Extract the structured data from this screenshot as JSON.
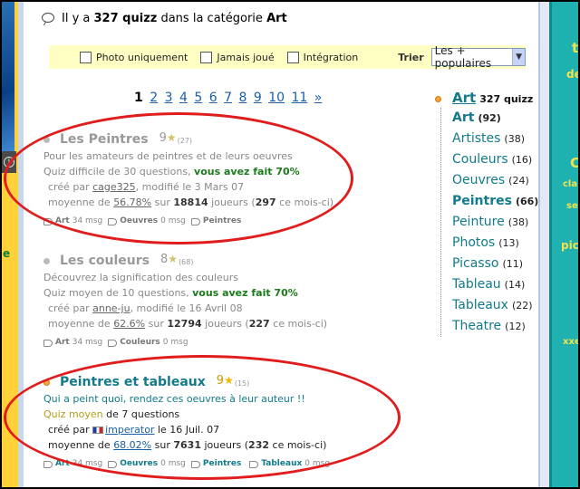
{
  "header": {
    "prefix": "Il y a",
    "count": "327 quizz",
    "middle": "dans la catégorie",
    "category": "Art"
  },
  "filters": {
    "options": [
      "Photo uniquement",
      "Jamais joué",
      "Intégration"
    ],
    "sort_label": "Trier",
    "sort_value": "Les + populaires"
  },
  "pagination": {
    "pages": [
      "1",
      "2",
      "3",
      "4",
      "5",
      "6",
      "7",
      "8",
      "9",
      "10",
      "11",
      "»"
    ],
    "current": "1"
  },
  "quizzes": [
    {
      "title": "Les Peintres",
      "rating": "9",
      "votes": "(27)",
      "desc": "Pour les amateurs de peintres et de leurs oeuvres",
      "level_text": "Quiz difficile de 30 questions,",
      "done": "vous avez fait 70%",
      "created_prefix": "créé par",
      "author": "cage325",
      "modified": ", modifié le 3 Mars 07",
      "avg_prefix": "moyenne de",
      "avg": "56.78%",
      "players_prefix": "sur",
      "players": "18814",
      "players_suffix": "joueurs (",
      "month": "297",
      "month_suffix": "ce mois-ci)",
      "tags": [
        {
          "name": "Art",
          "count": "34 msg"
        },
        {
          "name": "Oeuvres",
          "count": "0 msg"
        },
        {
          "name": "Peintres",
          "count": ""
        }
      ]
    },
    {
      "title": "Les couleurs",
      "rating": "8",
      "votes": "(68)",
      "desc": "Découvrez la signification des couleurs",
      "level_text": "Quiz moyen de 10 questions,",
      "done": "vous avez fait 70%",
      "created_prefix": "créé par",
      "author": "anne-ju",
      "modified": ", modifié le 16 Avril 08",
      "avg_prefix": "moyenne de",
      "avg": "62.6%",
      "players_prefix": "sur",
      "players": "12794",
      "players_suffix": "joueurs (",
      "month": "227",
      "month_suffix": "ce mois-ci)",
      "tags": [
        {
          "name": "Art",
          "count": "34 msg"
        },
        {
          "name": "Couleurs",
          "count": "0 msg"
        }
      ]
    },
    {
      "title": "Peintres et tableaux",
      "rating": "9",
      "votes": "(15)",
      "desc": "Qui a peint quoi, rendez ces oeuvres à leur auteur !!",
      "level": "Quiz moyen",
      "level_rest": "de 7 questions",
      "created_prefix": "créé par",
      "author": "imperator",
      "modified": "le 16 Juil. 07",
      "avg_prefix": "moyenne de",
      "avg": "68.02%",
      "players_prefix": "sur",
      "players": "7631",
      "players_suffix": "joueurs (",
      "month": "232",
      "month_suffix": "ce mois-ci)",
      "tags": [
        {
          "name": "Art",
          "count": "34 msg"
        },
        {
          "name": "Oeuvres",
          "count": "0 msg"
        },
        {
          "name": "Peintres",
          "count": ""
        },
        {
          "name": "Tableaux",
          "count": "0 msg"
        }
      ]
    }
  ],
  "categories": {
    "root": "Art",
    "root_total": "327 quizz",
    "items": [
      {
        "name": "Art",
        "count": "(92)"
      },
      {
        "name": "Artistes",
        "count": "(38)"
      },
      {
        "name": "Couleurs",
        "count": "(16)"
      },
      {
        "name": "Oeuvres",
        "count": "(24)"
      },
      {
        "name": "Peintres",
        "count": "(66)"
      },
      {
        "name": "Peinture",
        "count": "(38)"
      },
      {
        "name": "Photos",
        "count": "(13)"
      },
      {
        "name": "Picasso",
        "count": "(11)"
      },
      {
        "name": "Tableau",
        "count": "(14)"
      },
      {
        "name": "Tableaux",
        "count": "(22)"
      },
      {
        "name": "Theatre",
        "count": "(12)"
      }
    ]
  },
  "side_fragments": {
    "left_letter": "e",
    "right": [
      "ta",
      "de",
      "C",
      "cla",
      "se",
      "pic",
      "xxe"
    ]
  },
  "colors": {
    "accent": "#127a8a",
    "highlight_ring": "#e01c1c",
    "filter_bg": "#ffffc4",
    "right_strip": "#1fb0b0"
  }
}
